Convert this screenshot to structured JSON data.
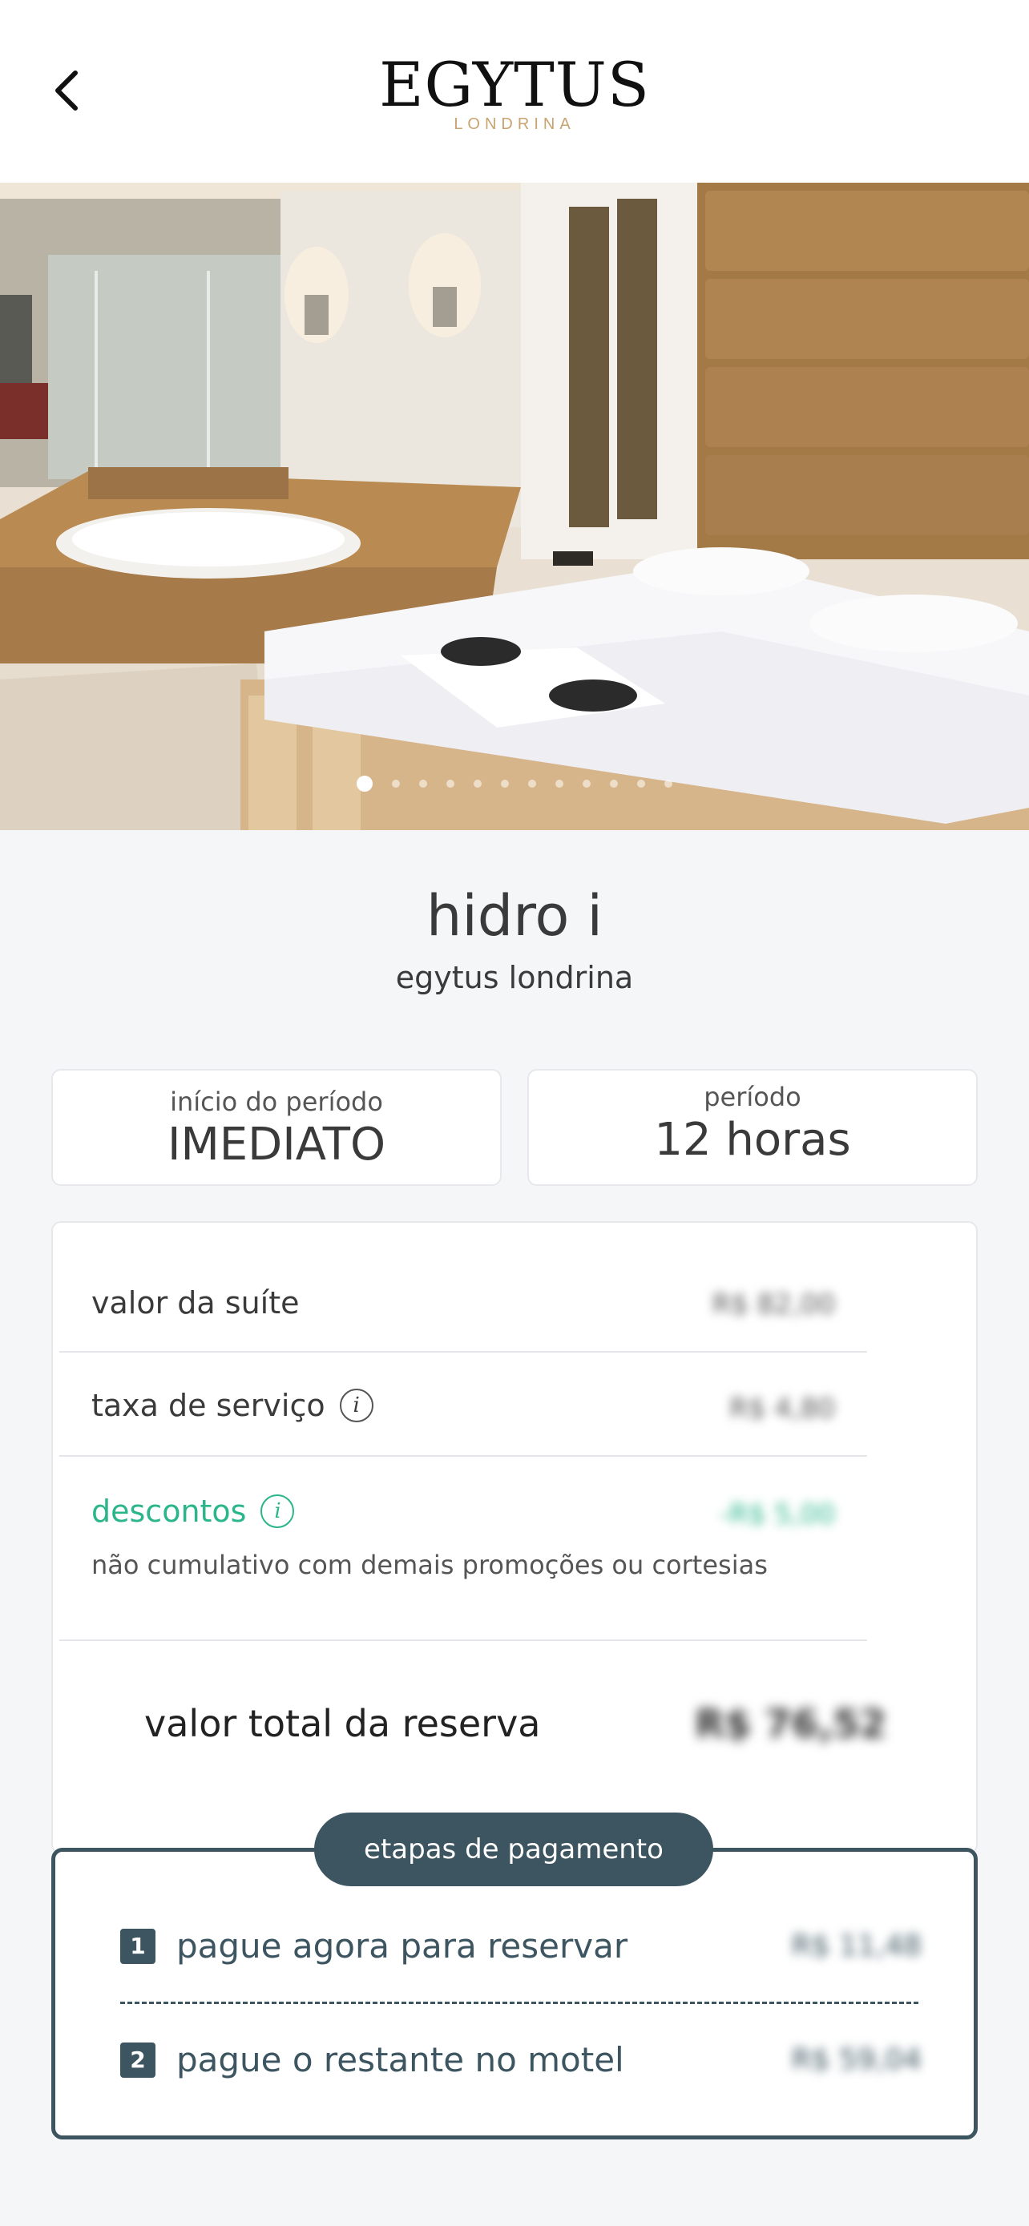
{
  "header": {
    "logo_main": "EGYTUS",
    "logo_sub": "LONDRINA",
    "back_label": "voltar"
  },
  "gallery": {
    "image_count": 12,
    "active_index": 0
  },
  "suite": {
    "name": "hidro i",
    "motel": "egytus londrina"
  },
  "period": {
    "start_label": "início do período",
    "start_value": "IMEDIATO",
    "duration_label": "período",
    "duration_value": "12 horas"
  },
  "pricing": {
    "suite_label": "valor da suíte",
    "suite_value": "R$ 82,00",
    "service_label": "taxa de serviço",
    "service_value": "R$ 4,80",
    "discount_label": "descontos",
    "discount_value": "-R$ 5,00",
    "discount_note": "não cumulativo com demais promoções ou cortesias",
    "total_label": "valor total da reserva",
    "total_value": "R$ 76,52"
  },
  "payment_steps": {
    "title": "etapas de pagamento",
    "steps": [
      {
        "num": "1",
        "label": "pague agora para reservar",
        "value": "R$ 11,48"
      },
      {
        "num": "2",
        "label": "pague o restante no motel",
        "value": "R$ 59,04"
      }
    ]
  },
  "colors": {
    "accent": "#3c5560",
    "discount": "#2bb58a",
    "logo_gold": "#c9a370"
  }
}
